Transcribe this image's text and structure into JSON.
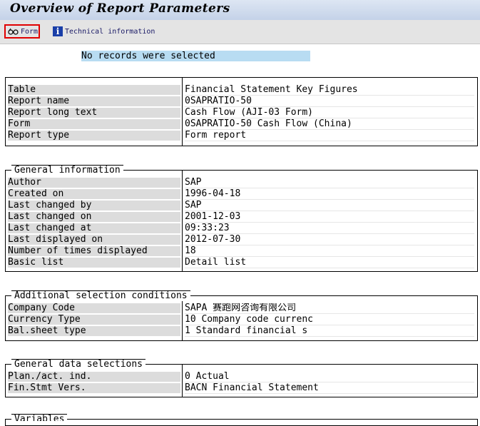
{
  "window": {
    "title": "Overview of Report Parameters"
  },
  "toolbar": {
    "form_label": "Form",
    "tech_info_label": "Technical information"
  },
  "message": "No records were selected",
  "report": {
    "rows": [
      {
        "label": "Table",
        "value": "Financial Statement Key Figures"
      },
      {
        "label": "Report name",
        "value": "0SAPRATIO-50"
      },
      {
        "label": "Report long text",
        "value": "Cash Flow (AJI-03 Form)"
      },
      {
        "label": "Form",
        "value": "0SAPRATIO-50 Cash Flow  (China)"
      },
      {
        "label": "Report type",
        "value": "Form report"
      }
    ]
  },
  "general_info": {
    "title": "General information",
    "rows": [
      {
        "label": "Author",
        "value": "SAP"
      },
      {
        "label": "Created on",
        "value": "1996-04-18"
      },
      {
        "label": "Last changed by",
        "value": "SAP"
      },
      {
        "label": "Last changed on",
        "value": "2001-12-03"
      },
      {
        "label": "Last changed at",
        "value": "09:33:23"
      },
      {
        "label": "Last displayed on",
        "value": "2012-07-30"
      },
      {
        "label": "Number of times displayed",
        "value": "18"
      },
      {
        "label": "Basic list",
        "value": "Detail list"
      }
    ]
  },
  "additional_selection": {
    "title": "Additional selection conditions",
    "rows": [
      {
        "label": "Company Code",
        "value": "SAPA 赛跑网咨询有限公司"
      },
      {
        "label": "Currency Type",
        "value": "10 Company code currenc"
      },
      {
        "label": "Bal.sheet type",
        "value": "1 Standard financial s"
      }
    ]
  },
  "general_data": {
    "title": "General data selections",
    "rows": [
      {
        "label": "Plan./act. ind.",
        "value": "0    Actual"
      },
      {
        "label": "Fin.Stmt Vers.",
        "value": "BACN Financial Statement"
      }
    ]
  },
  "variables": {
    "title": "Variables"
  }
}
